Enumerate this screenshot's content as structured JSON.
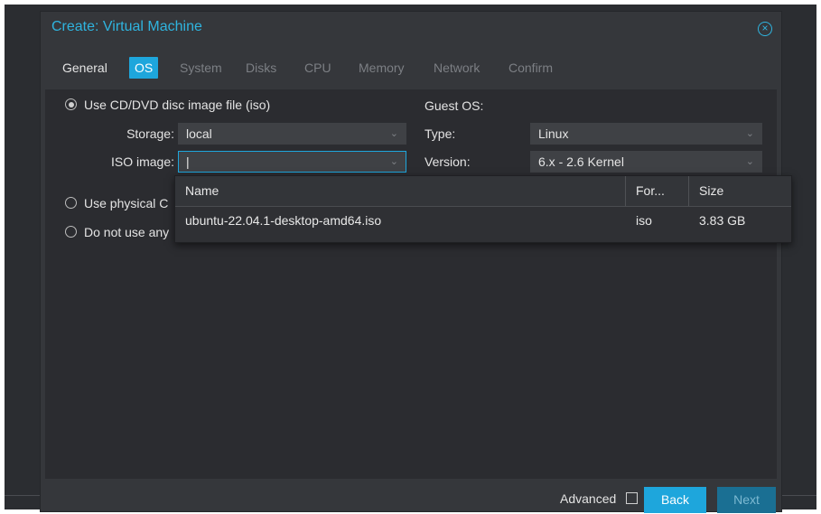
{
  "dialog": {
    "title": "Create: Virtual Machine",
    "close_icon": "close-circle-icon"
  },
  "tabs": [
    {
      "label": "General",
      "state": "enabled"
    },
    {
      "label": "OS",
      "state": "active"
    },
    {
      "label": "System",
      "state": "disabled"
    },
    {
      "label": "Disks",
      "state": "disabled"
    },
    {
      "label": "CPU",
      "state": "disabled"
    },
    {
      "label": "Memory",
      "state": "disabled"
    },
    {
      "label": "Network",
      "state": "disabled"
    },
    {
      "label": "Confirm",
      "state": "disabled"
    }
  ],
  "media": {
    "iso_option_label": "Use CD/DVD disc image file (iso)",
    "physical_option_label": "Use physical C",
    "none_option_label": "Do not use any",
    "storage_label": "Storage:",
    "storage_value": "local",
    "iso_label": "ISO image:",
    "iso_value": "|"
  },
  "guest_os": {
    "heading": "Guest OS:",
    "type_label": "Type:",
    "type_value": "Linux",
    "version_label": "Version:",
    "version_value": "6.x - 2.6 Kernel"
  },
  "iso_picker": {
    "columns": [
      "Name",
      "For...",
      "Size"
    ],
    "rows": [
      {
        "name": "ubuntu-22.04.1-desktop-amd64.iso",
        "format": "iso",
        "size": "3.83 GB"
      }
    ]
  },
  "footer": {
    "advanced_label": "Advanced",
    "back_label": "Back",
    "next_label": "Next"
  },
  "colors": {
    "accent": "#1ea6dc",
    "title": "#2fb4df",
    "background": "#35373b"
  }
}
